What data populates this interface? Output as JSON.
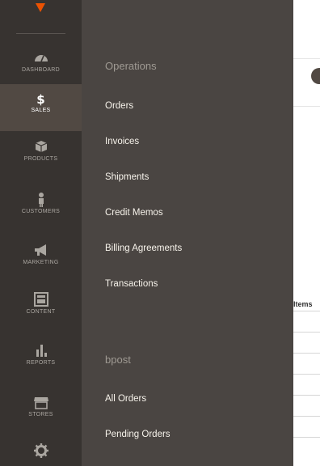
{
  "rail": {
    "items": [
      {
        "label": "DASHBOARD",
        "icon": "dashboard-icon"
      },
      {
        "label": "SALES",
        "icon": "dollar-icon",
        "active": true
      },
      {
        "label": "PRODUCTS",
        "icon": "box-icon"
      },
      {
        "label": "CUSTOMERS",
        "icon": "person-icon"
      },
      {
        "label": "MARKETING",
        "icon": "megaphone-icon"
      },
      {
        "label": "CONTENT",
        "icon": "content-icon"
      },
      {
        "label": "REPORTS",
        "icon": "bar-chart-icon"
      },
      {
        "label": "STORES",
        "icon": "store-icon"
      },
      {
        "label": "",
        "icon": "gear-icon"
      }
    ]
  },
  "submenu": {
    "sections": [
      {
        "title": "Operations",
        "links": [
          "Orders",
          "Invoices",
          "Shipments",
          "Credit Memos",
          "Billing Agreements",
          "Transactions"
        ]
      },
      {
        "title": "bpost",
        "links": [
          "All Orders",
          "Pending Orders"
        ]
      }
    ]
  },
  "background": {
    "column_header": "Items"
  },
  "colors": {
    "rail_bg": "#373330",
    "panel_bg": "#4a4542",
    "active_bg": "#514943",
    "accent_orange": "#eb5202"
  }
}
